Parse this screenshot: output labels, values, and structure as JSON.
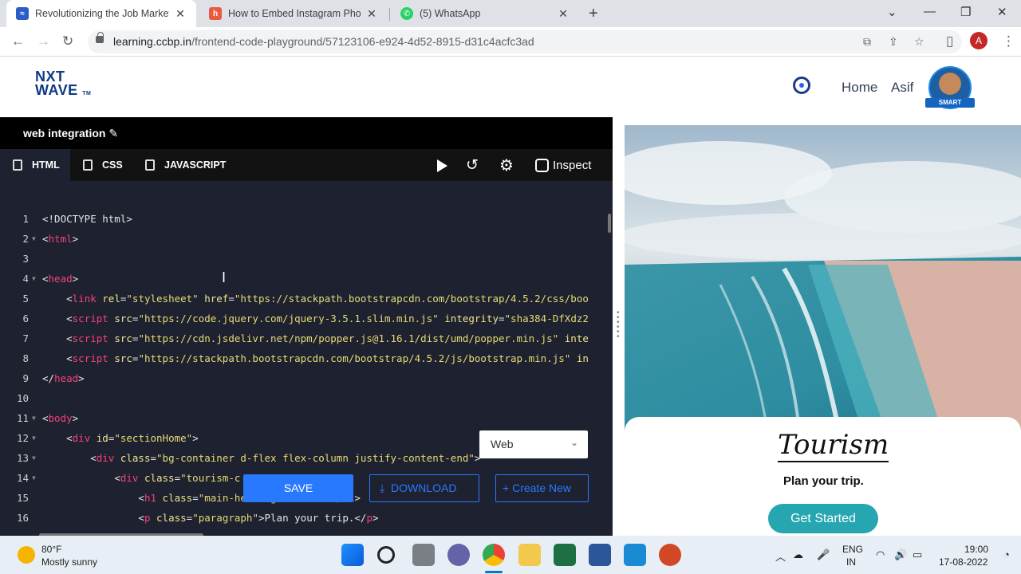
{
  "browser": {
    "tabs": [
      {
        "label": "Revolutionizing the Job Market |",
        "active": true
      },
      {
        "label": "How to Embed Instagram Photo",
        "active": false
      },
      {
        "label": "(5) WhatsApp",
        "active": false
      }
    ],
    "url_host": "learning.ccbp.in",
    "url_path": "/frontend-code-playground/57123106-e924-4d52-8915-d31c4acfc3ad",
    "profile_initial": "A"
  },
  "app": {
    "logo_line1": "NXT",
    "logo_line2": "WAVE",
    "logo_tm": "TM",
    "nav_home": "Home",
    "nav_user": "Asif",
    "avatar_badge": "SMART"
  },
  "editor": {
    "project_title": "web integration",
    "tabs": [
      "HTML",
      "CSS",
      "JAVASCRIPT"
    ],
    "inspect_label": "Inspect",
    "view_select": "Web",
    "save_label": "SAVE",
    "download_label": "DOWNLOAD",
    "create_label": "Create New",
    "lines": [
      {
        "n": "1",
        "fold": false,
        "indent": "",
        "parts": [
          [
            "p",
            "<!DOCTYPE html>"
          ]
        ]
      },
      {
        "n": "2",
        "fold": true,
        "indent": "",
        "parts": [
          [
            "p",
            "<"
          ],
          [
            "t",
            "html"
          ],
          [
            "p",
            ">"
          ]
        ]
      },
      {
        "n": "3",
        "fold": false,
        "indent": "",
        "parts": []
      },
      {
        "n": "4",
        "fold": true,
        "indent": "",
        "parts": [
          [
            "p",
            "<"
          ],
          [
            "t",
            "head"
          ],
          [
            "p",
            ">"
          ]
        ]
      },
      {
        "n": "5",
        "fold": false,
        "indent": "    ",
        "parts": [
          [
            "p",
            "<"
          ],
          [
            "t",
            "link"
          ],
          [
            "p",
            " "
          ],
          [
            "a",
            "rel"
          ],
          [
            "p",
            "="
          ],
          [
            "s",
            "\"stylesheet\""
          ],
          [
            "p",
            " "
          ],
          [
            "a",
            "href"
          ],
          [
            "p",
            "="
          ],
          [
            "s",
            "\"https://stackpath.bootstrapcdn.com/bootstrap/4.5.2/css/boo"
          ]
        ]
      },
      {
        "n": "6",
        "fold": false,
        "indent": "    ",
        "parts": [
          [
            "p",
            "<"
          ],
          [
            "t",
            "script"
          ],
          [
            "p",
            " "
          ],
          [
            "a",
            "src"
          ],
          [
            "p",
            "="
          ],
          [
            "s",
            "\"https://code.jquery.com/jquery-3.5.1.slim.min.js\""
          ],
          [
            "p",
            " "
          ],
          [
            "a",
            "integrity"
          ],
          [
            "p",
            "="
          ],
          [
            "s",
            "\"sha384-DfXdz2"
          ]
        ]
      },
      {
        "n": "7",
        "fold": false,
        "indent": "    ",
        "parts": [
          [
            "p",
            "<"
          ],
          [
            "t",
            "script"
          ],
          [
            "p",
            " "
          ],
          [
            "a",
            "src"
          ],
          [
            "p",
            "="
          ],
          [
            "s",
            "\"https://cdn.jsdelivr.net/npm/popper.js@1.16.1/dist/umd/popper.min.js\""
          ],
          [
            "p",
            " "
          ],
          [
            "a",
            "inte"
          ]
        ]
      },
      {
        "n": "8",
        "fold": false,
        "indent": "    ",
        "parts": [
          [
            "p",
            "<"
          ],
          [
            "t",
            "script"
          ],
          [
            "p",
            " "
          ],
          [
            "a",
            "src"
          ],
          [
            "p",
            "="
          ],
          [
            "s",
            "\"https://stackpath.bootstrapcdn.com/bootstrap/4.5.2/js/bootstrap.min.js\""
          ],
          [
            "p",
            " "
          ],
          [
            "a",
            "in"
          ]
        ]
      },
      {
        "n": "9",
        "fold": false,
        "indent": "",
        "parts": [
          [
            "p",
            "</"
          ],
          [
            "t",
            "head"
          ],
          [
            "p",
            ">"
          ]
        ]
      },
      {
        "n": "10",
        "fold": false,
        "indent": "",
        "parts": []
      },
      {
        "n": "11",
        "fold": true,
        "indent": "",
        "parts": [
          [
            "p",
            "<"
          ],
          [
            "t",
            "body"
          ],
          [
            "p",
            ">"
          ]
        ]
      },
      {
        "n": "12",
        "fold": true,
        "indent": "    ",
        "parts": [
          [
            "p",
            "<"
          ],
          [
            "t",
            "div"
          ],
          [
            "p",
            " "
          ],
          [
            "a",
            "id"
          ],
          [
            "p",
            "="
          ],
          [
            "s",
            "\"sectionHome\""
          ],
          [
            "p",
            ">"
          ]
        ]
      },
      {
        "n": "13",
        "fold": true,
        "indent": "        ",
        "parts": [
          [
            "p",
            "<"
          ],
          [
            "t",
            "div"
          ],
          [
            "p",
            " "
          ],
          [
            "a",
            "class"
          ],
          [
            "p",
            "="
          ],
          [
            "s",
            "\"bg-container d-flex flex-column justify-content-end\""
          ],
          [
            "p",
            ">"
          ]
        ]
      },
      {
        "n": "14",
        "fold": true,
        "indent": "            ",
        "parts": [
          [
            "p",
            "<"
          ],
          [
            "t",
            "div"
          ],
          [
            "p",
            " "
          ],
          [
            "a",
            "class"
          ],
          [
            "p",
            "="
          ],
          [
            "s",
            "\"tourism-c"
          ]
        ]
      },
      {
        "n": "15",
        "fold": false,
        "indent": "                ",
        "parts": [
          [
            "p",
            "<"
          ],
          [
            "t",
            "h1"
          ],
          [
            "p",
            " "
          ],
          [
            "a",
            "class"
          ],
          [
            "p",
            "="
          ],
          [
            "s",
            "\"main-heading\""
          ],
          [
            "p",
            ">Tourism</"
          ],
          [
            "t",
            "h1"
          ],
          [
            "p",
            ">"
          ]
        ]
      },
      {
        "n": "16",
        "fold": false,
        "indent": "                ",
        "parts": [
          [
            "p",
            "<"
          ],
          [
            "t",
            "p"
          ],
          [
            "p",
            " "
          ],
          [
            "a",
            "class"
          ],
          [
            "p",
            "="
          ],
          [
            "s",
            "\"paragraph\""
          ],
          [
            "p",
            ">Plan your trip.</"
          ],
          [
            "t",
            "p"
          ],
          [
            "p",
            ">"
          ]
        ]
      }
    ]
  },
  "preview": {
    "title": "Tourism",
    "subtitle": "Plan your trip.",
    "button": "Get Started"
  },
  "taskbar": {
    "temp": "80°F",
    "weather": "Mostly sunny",
    "lang1": "ENG",
    "lang2": "IN",
    "time": "19:00",
    "date": "17-08-2022"
  }
}
